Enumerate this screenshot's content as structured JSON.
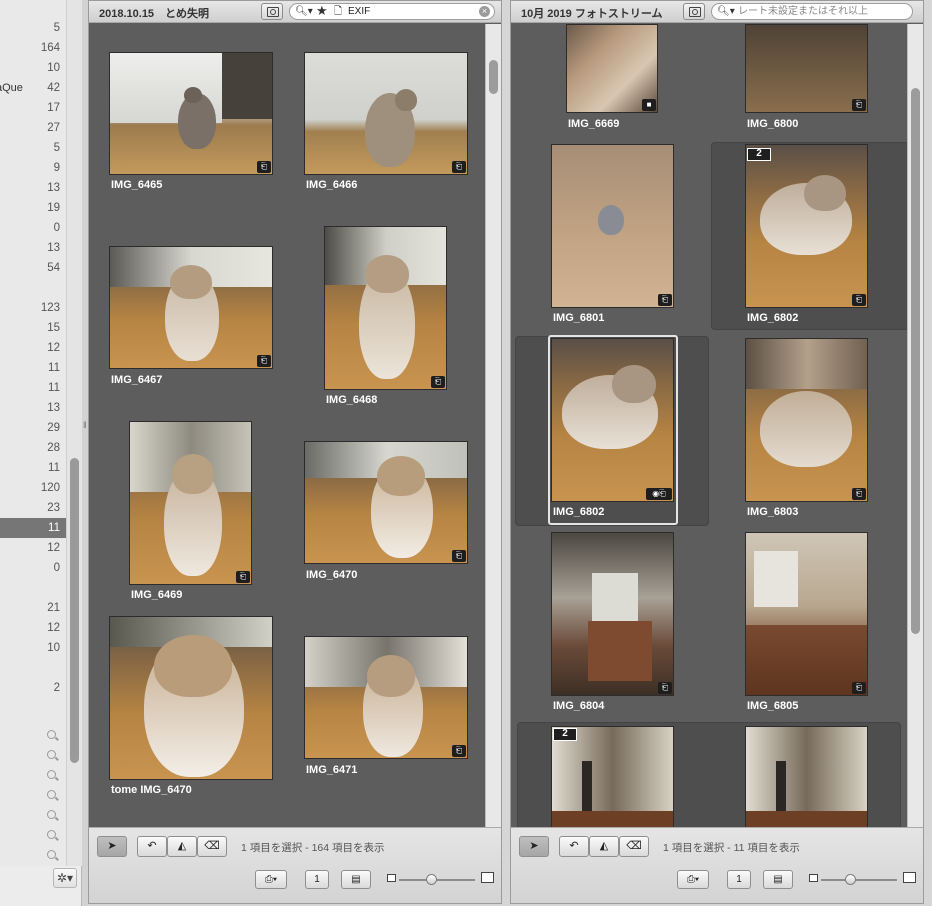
{
  "sidebar": {
    "partial_name": "aQue",
    "rows": [
      "",
      "5",
      "164",
      "10",
      "42",
      "17",
      "27",
      "5",
      "9",
      "13",
      "19",
      "0",
      "13",
      "54",
      "",
      "123",
      "15",
      "12",
      "11",
      "11",
      "13",
      "29",
      "28",
      "11",
      "120",
      "23",
      "11",
      "12",
      "0",
      "",
      "21",
      "12",
      "10",
      "",
      "2"
    ],
    "selected_index": 26,
    "search_icon_rows": 7
  },
  "left_panel": {
    "title": "2018.10.15　とめ失明",
    "search": {
      "value": "EXIF"
    },
    "photos": [
      {
        "name": "IMG_6465"
      },
      {
        "name": "IMG_6466"
      },
      {
        "name": "IMG_6467"
      },
      {
        "name": "IMG_6468"
      },
      {
        "name": "IMG_6469"
      },
      {
        "name": "IMG_6470"
      },
      {
        "name": "tome IMG_6470"
      },
      {
        "name": "IMG_6471"
      }
    ],
    "status": "1 項目を選択 - 164 項目を表示",
    "zoom_level": 0.42
  },
  "right_panel": {
    "title": "10月 2019 フォトストリーム",
    "search": {
      "placeholder": "レート未設定またはそれ以上"
    },
    "photos": [
      {
        "name": "IMG_6669"
      },
      {
        "name": "IMG_6800"
      },
      {
        "name": "IMG_6801"
      },
      {
        "name": "IMG_6802"
      },
      {
        "name": "IMG_6802"
      },
      {
        "name": "IMG_6803"
      },
      {
        "name": "IMG_6804"
      },
      {
        "name": "IMG_6805"
      }
    ],
    "stack_counts": [
      "2",
      "2"
    ],
    "status": "1 項目を選択 - 11 項目を表示",
    "zoom_level": 0.38
  },
  "footer_buttons": {
    "single_view": "1"
  },
  "icons": {
    "view_button": "viewer-icon",
    "search": "magnifier-icon",
    "rating": "star-icon",
    "arrow": "pointer-tool-icon",
    "rotate": "rotate-icon",
    "straighten": "straighten-icon",
    "retouch": "retouch-icon",
    "badge": "adjusted-badge-icon",
    "video": "video-badge-icon"
  }
}
